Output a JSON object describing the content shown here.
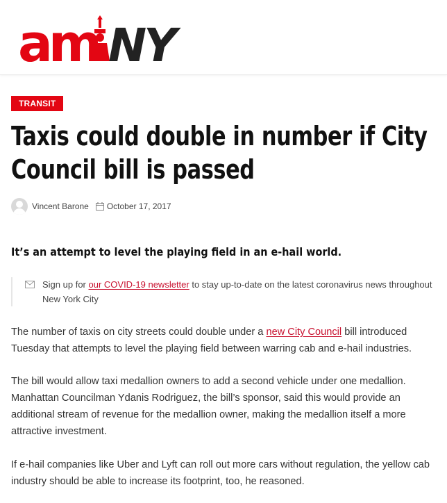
{
  "site": {
    "logo_text": "amNY",
    "logo_colors": {
      "am": "#e30613",
      "ny": "#222222"
    }
  },
  "article": {
    "category": "TRANSIT",
    "title": "Taxis could double in number if City Council bill is passed",
    "author": "Vincent Barone",
    "date": "October 17, 2017",
    "subheadline": "It’s an attempt to level the playing field in an e-hail world.",
    "newsletter": {
      "before": "Sign up for ",
      "link": "our COVID-19 newsletter",
      "after": " to stay up-to-date on the latest coronavirus news throughout New York City"
    },
    "paragraphs": [
      {
        "before": "The number of taxis on city streets could double under a ",
        "link": "new City Council",
        "after": " bill introduced Tuesday that attempts to level the playing field between warring cab and e-hail industries."
      },
      {
        "text": "The bill would allow taxi medallion owners to add a second vehicle under one medallion. Manhattan Councilman Ydanis Rodriguez, the bill’s sponsor, said this would provide an additional stream of revenue for the medallion owner, making the medallion itself a more attractive investment."
      },
      {
        "text": "If e-hail companies like Uber and Lyft can roll out more cars without regulation, the yellow cab industry should be able to increase its footprint, too, he reasoned."
      }
    ]
  },
  "colors": {
    "accent": "#e30613",
    "link": "#c8102e"
  }
}
